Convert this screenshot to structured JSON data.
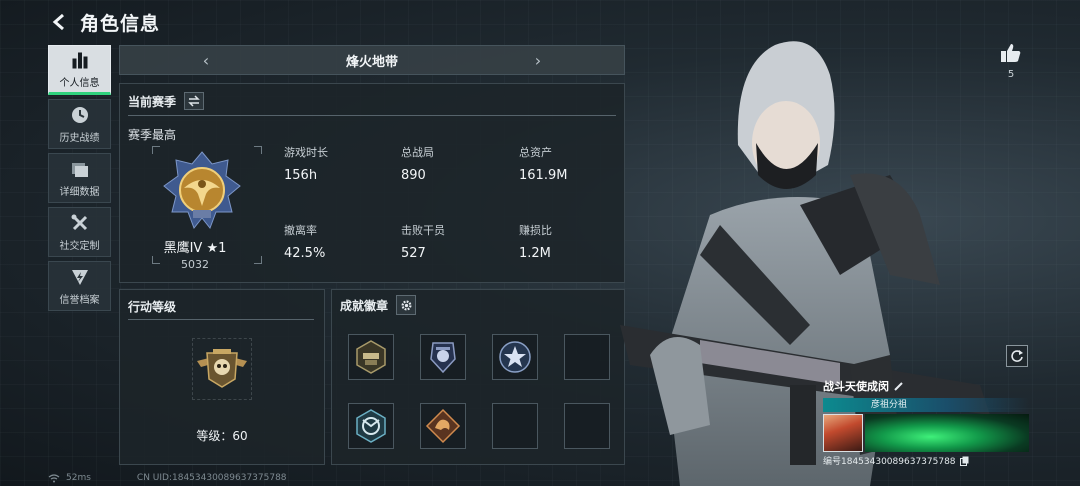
{
  "header": {
    "title": "角色信息"
  },
  "sidebar": {
    "items": [
      {
        "label": "个人信息",
        "icon": "bar-chart-icon",
        "active": true
      },
      {
        "label": "历史战绩",
        "icon": "clock-icon",
        "active": false
      },
      {
        "label": "详细数据",
        "icon": "folder-icon",
        "active": false
      },
      {
        "label": "社交定制",
        "icon": "tools-icon",
        "active": false
      },
      {
        "label": "信誉档案",
        "icon": "shield-bolt-icon",
        "active": false
      }
    ]
  },
  "map_selector": {
    "current": "烽火地带",
    "prev": "‹",
    "next": "›"
  },
  "season": {
    "title": "当前赛季",
    "subtitle": "赛季最高",
    "rank": {
      "name": "黑鹰IV ★1",
      "score": "5032"
    },
    "stats": [
      {
        "label": "游戏时长",
        "value": "156h"
      },
      {
        "label": "总战局",
        "value": "890"
      },
      {
        "label": "总资产",
        "value": "161.9M"
      },
      {
        "label": "撤离率",
        "value": "42.5%"
      },
      {
        "label": "击败干员",
        "value": "527"
      },
      {
        "label": "赚损比",
        "value": "1.2M"
      }
    ]
  },
  "action_level": {
    "title": "行动等级",
    "level_text": "等级：60"
  },
  "badges": {
    "title": "成就徽章",
    "slots": [
      {
        "icon": "fire-department-badge-icon"
      },
      {
        "icon": "police-badge-icon"
      },
      {
        "icon": "star-shield-badge-icon"
      },
      {
        "icon": "empty-slot"
      },
      {
        "icon": "arrows-globe-badge-icon"
      },
      {
        "icon": "dragon-badge-icon"
      },
      {
        "icon": "empty-slot"
      },
      {
        "icon": "empty-slot"
      }
    ]
  },
  "likes": {
    "count": "5"
  },
  "player_card": {
    "name": "战斗天使成闵",
    "guild": "彦祖分祖",
    "id_text": "编号18453430089637375788"
  },
  "footer": {
    "ping": "52ms",
    "uid": "CN UID:18453430089637375788"
  },
  "colors": {
    "accent_green": "#2fd27d",
    "panel_bg": "#1c2429",
    "text_primary": "#f2f5f7"
  }
}
